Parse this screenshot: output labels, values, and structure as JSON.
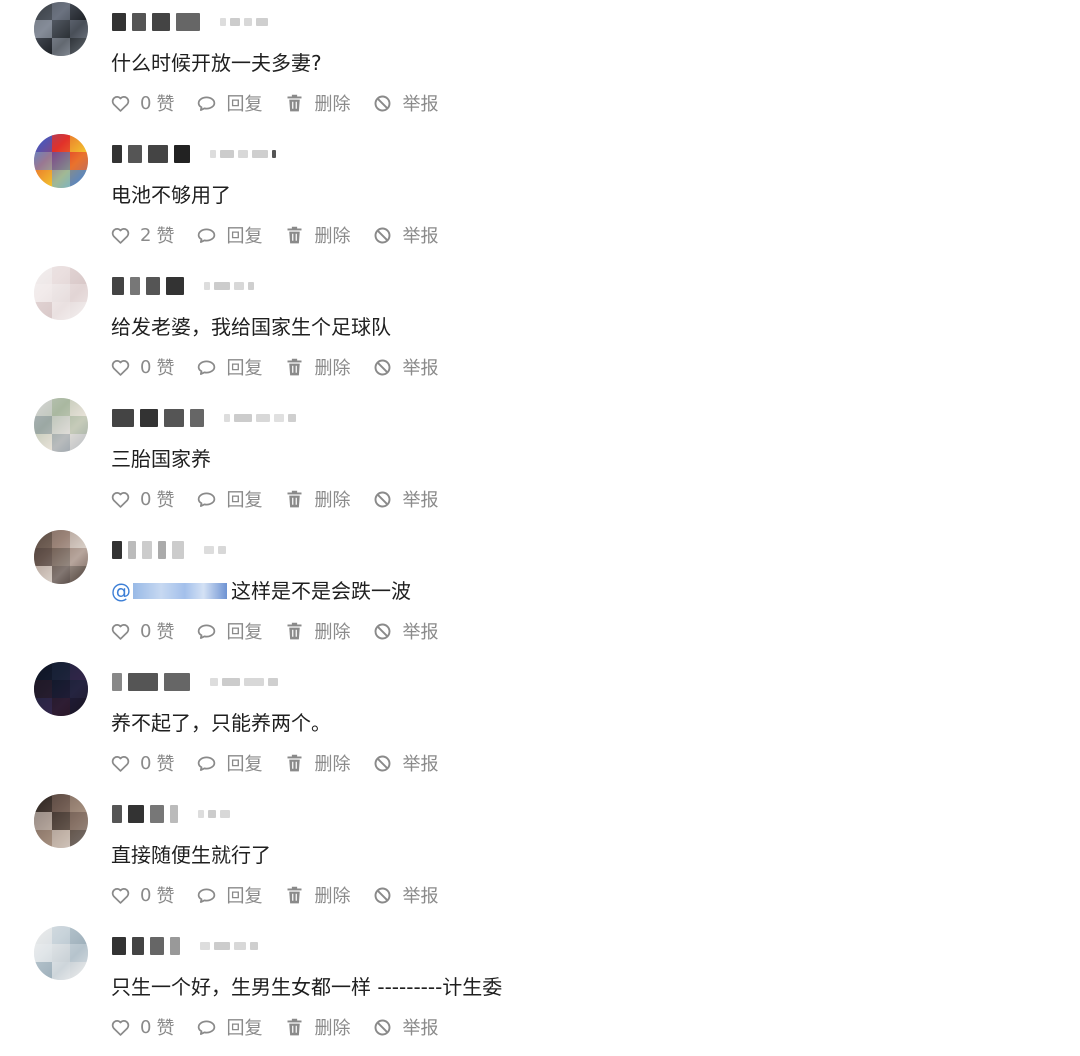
{
  "labels": {
    "like": "赞",
    "reply": "回复",
    "delete": "删除",
    "report": "举报"
  },
  "colors": {
    "text": "#1f1f1f",
    "action": "#8a8a8a",
    "mention": "#3d7fd6"
  },
  "comments": [
    {
      "text": "什么时候开放一夫多妻?",
      "likes": "0",
      "avatar": [
        "#3a3f46",
        "#6b7280",
        "#1f2328",
        "#9aa3ad"
      ],
      "name": [
        [
          "#333",
          6,
          14
        ],
        [
          "#555",
          6,
          14
        ],
        [
          "#444",
          6,
          18
        ],
        [
          "#666",
          6,
          24
        ]
      ],
      "meta": [
        [
          "#ddd",
          4,
          6
        ],
        [
          "#ccc",
          4,
          10
        ],
        [
          "#d8d8d8",
          4,
          8
        ],
        [
          "#cfcfcf",
          4,
          12
        ]
      ]
    },
    {
      "text": "电池不够用了",
      "likes": "2",
      "avatar": [
        "#2a5fd8",
        "#e2322a",
        "#f2c230",
        "#5fb0e8"
      ],
      "name": [
        [
          "#333",
          6,
          10
        ],
        [
          "#555",
          6,
          14
        ],
        [
          "#444",
          6,
          20
        ],
        [
          "#222",
          6,
          16
        ]
      ],
      "meta": [
        [
          "#ddd",
          4,
          6
        ],
        [
          "#ccc",
          4,
          14
        ],
        [
          "#d8d8d8",
          4,
          10
        ],
        [
          "#cfcfcf",
          4,
          16
        ],
        [
          "#555",
          4,
          4
        ]
      ]
    },
    {
      "text": "给发老婆，我给国家生个足球队",
      "likes": "0",
      "avatar": [
        "#f2eeee",
        "#e9dede",
        "#d9c9c9",
        "#f8f4f4"
      ],
      "name": [
        [
          "#444",
          6,
          12
        ],
        [
          "#777",
          6,
          10
        ],
        [
          "#555",
          6,
          14
        ],
        [
          "#333",
          6,
          18
        ]
      ],
      "meta": [
        [
          "#ddd",
          4,
          6
        ],
        [
          "#ccc",
          4,
          16
        ],
        [
          "#d8d8d8",
          4,
          10
        ],
        [
          "#cfcfcf",
          4,
          6
        ]
      ]
    },
    {
      "text": "三胎国家养",
      "likes": "0",
      "avatar": [
        "#d6d6d6",
        "#a9b8a0",
        "#e8e2d8",
        "#8f9aa6"
      ],
      "name": [
        [
          "#444",
          6,
          22
        ],
        [
          "#333",
          6,
          18
        ],
        [
          "#555",
          6,
          20
        ],
        [
          "#666",
          6,
          14
        ]
      ],
      "meta": [
        [
          "#ddd",
          4,
          6
        ],
        [
          "#ccc",
          4,
          18
        ],
        [
          "#d8d8d8",
          4,
          14
        ],
        [
          "#e0e0e0",
          4,
          10
        ],
        [
          "#cfcfcf",
          4,
          8
        ]
      ]
    },
    {
      "text": "这样是不是会跌一波",
      "likes": "0",
      "mention": "@",
      "avatar": [
        "#5a4a42",
        "#9a8478",
        "#d9cfc8",
        "#3a2e2a"
      ],
      "name": [
        [
          "#333",
          6,
          10
        ],
        [
          "#bbb",
          6,
          8
        ],
        [
          "#ccc",
          6,
          10
        ],
        [
          "#aaa",
          6,
          8
        ],
        [
          "#ccc",
          6,
          12
        ]
      ],
      "meta": [
        [
          "#ddd",
          4,
          10
        ],
        [
          "#d8d8d8",
          4,
          8
        ]
      ]
    },
    {
      "text": "养不起了，只能养两个。",
      "likes": "0",
      "avatar": [
        "#0e1424",
        "#1a2338",
        "#33264a",
        "#2a1520"
      ],
      "name": [
        [
          "#888",
          6,
          10
        ],
        [
          "#555",
          6,
          30
        ],
        [
          "#666",
          6,
          26
        ]
      ],
      "meta": [
        [
          "#ddd",
          4,
          8
        ],
        [
          "#ccc",
          4,
          18
        ],
        [
          "#d8d8d8",
          4,
          20
        ],
        [
          "#cfcfcf",
          4,
          10
        ]
      ]
    },
    {
      "text": "直接随便生就行了",
      "likes": "0",
      "avatar": [
        "#2b2420",
        "#6e5a50",
        "#a69080",
        "#d9cfc8"
      ],
      "name": [
        [
          "#555",
          6,
          10
        ],
        [
          "#333",
          6,
          16
        ],
        [
          "#777",
          6,
          14
        ],
        [
          "#bbb",
          6,
          8
        ]
      ],
      "meta": [
        [
          "#ddd",
          4,
          6
        ],
        [
          "#ccc",
          4,
          8
        ],
        [
          "#d8d8d8",
          4,
          10
        ]
      ]
    },
    {
      "text": "只生一个好，生男生女都一样 ---------计生委",
      "likes": "0",
      "avatar": [
        "#ececec",
        "#c8d3da",
        "#9fb0bb",
        "#f4f4f4"
      ],
      "name": [
        [
          "#333",
          6,
          14
        ],
        [
          "#444",
          6,
          12
        ],
        [
          "#666",
          6,
          14
        ],
        [
          "#999",
          6,
          10
        ]
      ],
      "meta": [
        [
          "#ddd",
          4,
          10
        ],
        [
          "#ccc",
          4,
          16
        ],
        [
          "#d8d8d8",
          4,
          12
        ],
        [
          "#cfcfcf",
          4,
          8
        ]
      ]
    }
  ]
}
